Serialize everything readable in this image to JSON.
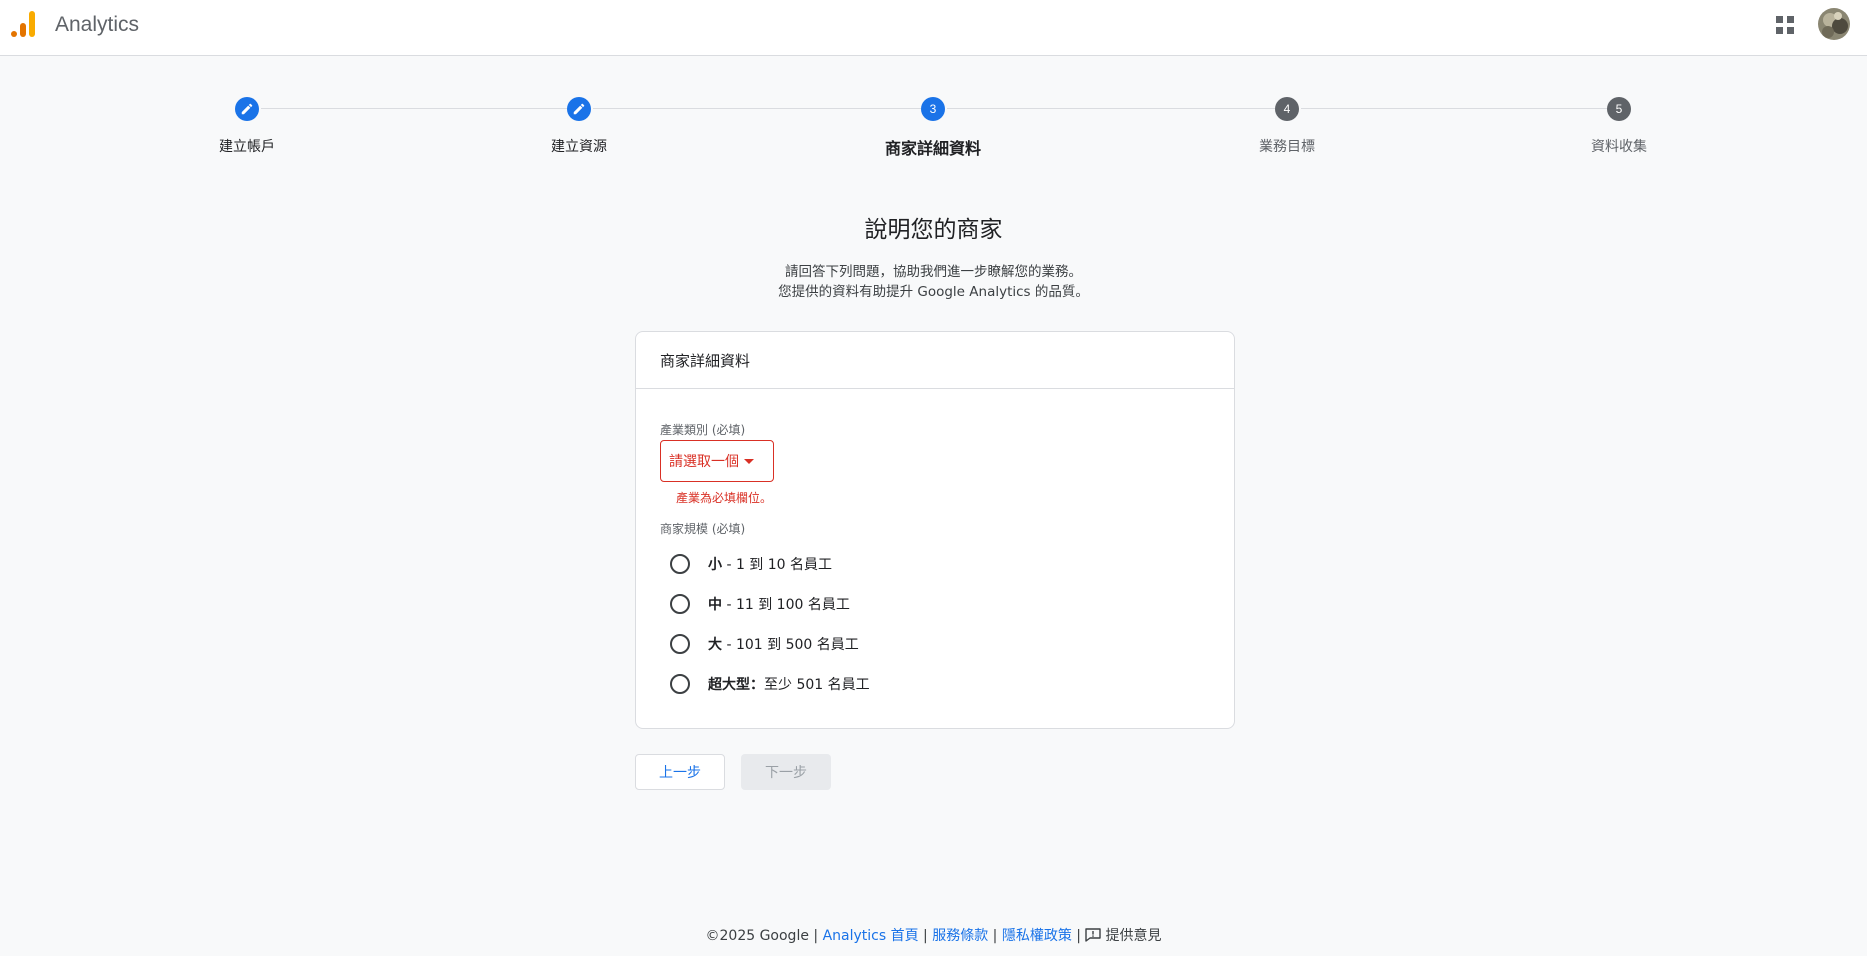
{
  "header": {
    "app_title": "Analytics",
    "logo_icon": "analytics-logo-icon",
    "apps_icon": "apps-grid-icon",
    "avatar_icon": "user-avatar-icon"
  },
  "stepper": {
    "steps": [
      {
        "number": "1",
        "label": "建立帳戶",
        "state": "done"
      },
      {
        "number": "2",
        "label": "建立資源",
        "state": "done"
      },
      {
        "number": "3",
        "label": "商家詳細資料",
        "state": "active"
      },
      {
        "number": "4",
        "label": "業務目標",
        "state": "todo"
      },
      {
        "number": "5",
        "label": "資料收集",
        "state": "todo"
      }
    ]
  },
  "main": {
    "title": "說明您的商家",
    "subtitle_line1": "請回答下列問題，協助我們進一步瞭解您的業務。",
    "subtitle_line2": "您提供的資料有助提升 Google Analytics 的品質。"
  },
  "card": {
    "header": "商家詳細資料",
    "industry_label": "產業類別 (必填)",
    "industry_value": "請選取一個",
    "industry_error": "產業為必填欄位。",
    "size_label": "商家規模 (必填)",
    "size_options": [
      {
        "bold": "小",
        "rest": " - 1 到 10 名員工"
      },
      {
        "bold": "中",
        "rest": " - 11 到 100 名員工"
      },
      {
        "bold": "大",
        "rest": " - 101 到 500 名員工"
      },
      {
        "bold": "超大型：",
        "rest": "至少 501 名員工"
      }
    ]
  },
  "buttons": {
    "back": "上一步",
    "next": "下一步"
  },
  "footer": {
    "copyright": "©2025 Google",
    "sep": " | ",
    "home": "Analytics 首頁",
    "terms": "服務條款",
    "privacy": "隱私權政策",
    "feedback": "提供意見"
  },
  "colors": {
    "accent": "#1a73e8",
    "error": "#d93025",
    "logo_orange": "#f9ab00",
    "logo_dark_orange": "#e37400"
  }
}
